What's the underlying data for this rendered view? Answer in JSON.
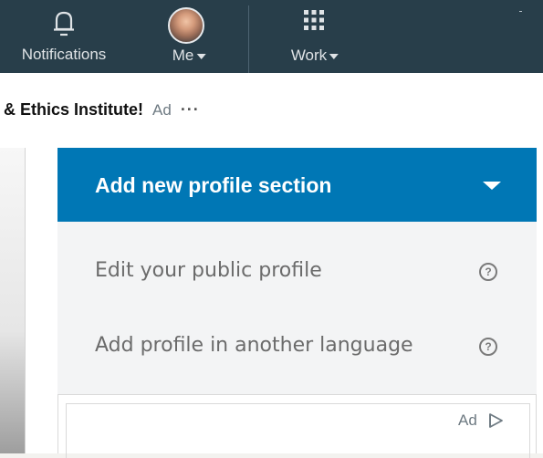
{
  "nav": {
    "notifications_label": "Notifications",
    "me_label": "Me",
    "work_label": "Work"
  },
  "ad_banner": {
    "title": "& Ethics Institute!",
    "ad_tag": "Ad",
    "more": "···"
  },
  "profile_actions": {
    "add_section_label": "Add new profile section",
    "edit_public_profile_label": "Edit your public profile",
    "add_language_label": "Add profile in another language",
    "help_glyph": "?"
  },
  "ad_card": {
    "ad_label": "Ad"
  },
  "icons": {
    "notifications": "bell-icon",
    "me": "avatar",
    "work": "grid-icon",
    "dropdown": "caret-down-icon",
    "help": "question-circle-icon",
    "ad_choices": "ad-play-icon"
  },
  "colors": {
    "nav_background": "#283e4a",
    "nav_text": "#dfe3e6",
    "primary_button": "#0077b5",
    "link_text": "#6b6b6b"
  }
}
